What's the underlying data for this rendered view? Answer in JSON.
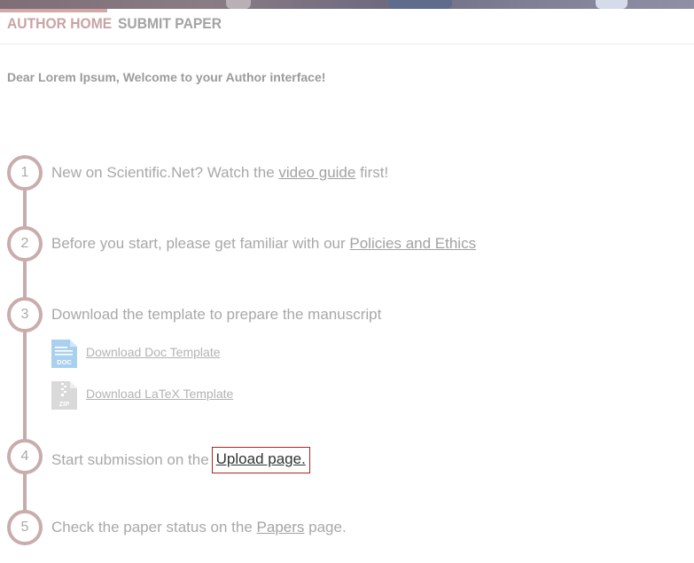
{
  "nav": {
    "tabs": [
      {
        "label": "AUTHOR HOME",
        "active": true
      },
      {
        "label": "SUBMIT PAPER",
        "active": false
      }
    ]
  },
  "welcome": "Dear Lorem Ipsum, Welcome to your Author interface!",
  "steps": [
    {
      "number": "1",
      "before": "New on Scientific.Net? Watch the ",
      "link": "video guide",
      "after": " first!"
    },
    {
      "number": "2",
      "before": "Before you start, please get familiar with our ",
      "link": "Policies and Ethics",
      "after": ""
    },
    {
      "number": "3",
      "before": "Download the template to prepare the manuscript",
      "link": "",
      "after": ""
    },
    {
      "number": "4",
      "before": "Start submission on the",
      "link": "Upload page",
      "after": "."
    },
    {
      "number": "5",
      "before": "Check the paper status on the ",
      "link": "Papers",
      "after": " page."
    }
  ],
  "downloads": [
    {
      "label": "Download Doc Template",
      "icon": "doc-file-icon",
      "badge": "DOC",
      "color": "#a9d0ef"
    },
    {
      "label": "Download LaTeX Template",
      "icon": "zip-file-icon",
      "badge": "ZIP",
      "color": "#d9d9d9"
    }
  ],
  "colors": {
    "accent": "#d6a7a7",
    "timeline": "#c7abab",
    "highlight_border": "#b22222"
  }
}
